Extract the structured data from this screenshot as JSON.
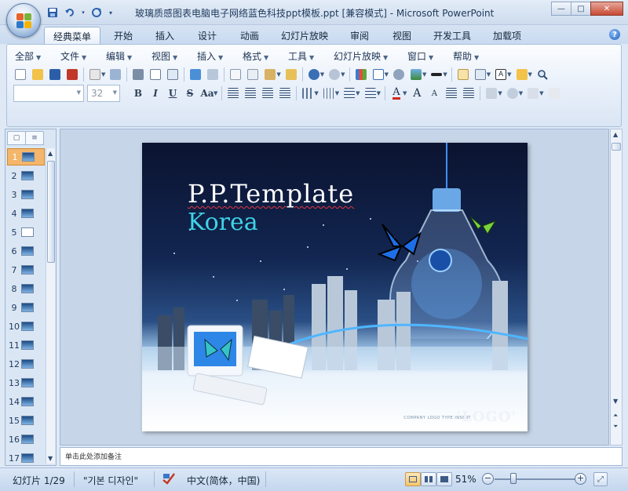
{
  "window": {
    "title": "玻璃质感图表电脑电子网络蓝色科技ppt模板.ppt [兼容模式] - Microsoft PowerPoint",
    "minimize_glyph": "—",
    "maximize_glyph": "□",
    "close_glyph": "✕"
  },
  "quick_access": [
    "save-icon",
    "undo-icon",
    "redo-icon",
    "customize-icon"
  ],
  "tabs": [
    {
      "label": "经典菜单",
      "active": true
    },
    {
      "label": "开始"
    },
    {
      "label": "插入"
    },
    {
      "label": "设计"
    },
    {
      "label": "动画"
    },
    {
      "label": "幻灯片放映"
    },
    {
      "label": "审阅"
    },
    {
      "label": "视图"
    },
    {
      "label": "开发工具"
    },
    {
      "label": "加载项"
    }
  ],
  "help_glyph": "?",
  "menus": [
    {
      "label": "全部"
    },
    {
      "label": "文件"
    },
    {
      "label": "编辑"
    },
    {
      "label": "视图"
    },
    {
      "label": "插入"
    },
    {
      "label": "格式"
    },
    {
      "label": "工具"
    },
    {
      "label": "幻灯片放映"
    },
    {
      "label": "窗口"
    },
    {
      "label": "帮助"
    }
  ],
  "font": {
    "name_value": "",
    "size_value": "32"
  },
  "format_buttons": {
    "bold": "B",
    "italic": "I",
    "underline": "U",
    "strike": "S",
    "case": "Aa"
  },
  "slides_panel": {
    "tab_slides_glyph": "▢",
    "tab_outline_glyph": "≡",
    "slides": [
      {
        "number": "1",
        "active": true
      },
      {
        "number": "2"
      },
      {
        "number": "3"
      },
      {
        "number": "4"
      },
      {
        "number": "5"
      },
      {
        "number": "6"
      },
      {
        "number": "7"
      },
      {
        "number": "8"
      },
      {
        "number": "9"
      },
      {
        "number": "10"
      },
      {
        "number": "11"
      },
      {
        "number": "12"
      },
      {
        "number": "13"
      },
      {
        "number": "14"
      },
      {
        "number": "15"
      },
      {
        "number": "16"
      },
      {
        "number": "17"
      }
    ]
  },
  "slide": {
    "title": "P.P.Template",
    "subtitle": "Korea",
    "logo": "'LOGO'",
    "company": "COMPANY LOGO TYPE INSERT"
  },
  "notes_placeholder": "单击此处添加备注",
  "status": {
    "slide_counter": "幻灯片 1/29",
    "theme": "\"기본 디자인\"",
    "language": "中文(简体，中国)",
    "zoom": "51%",
    "zoom_out_glyph": "−",
    "zoom_in_glyph": "+"
  },
  "colors": {
    "accent": "#f3b66a",
    "subtitle": "#3fd3e8",
    "ribbon": "#dae5f4"
  }
}
